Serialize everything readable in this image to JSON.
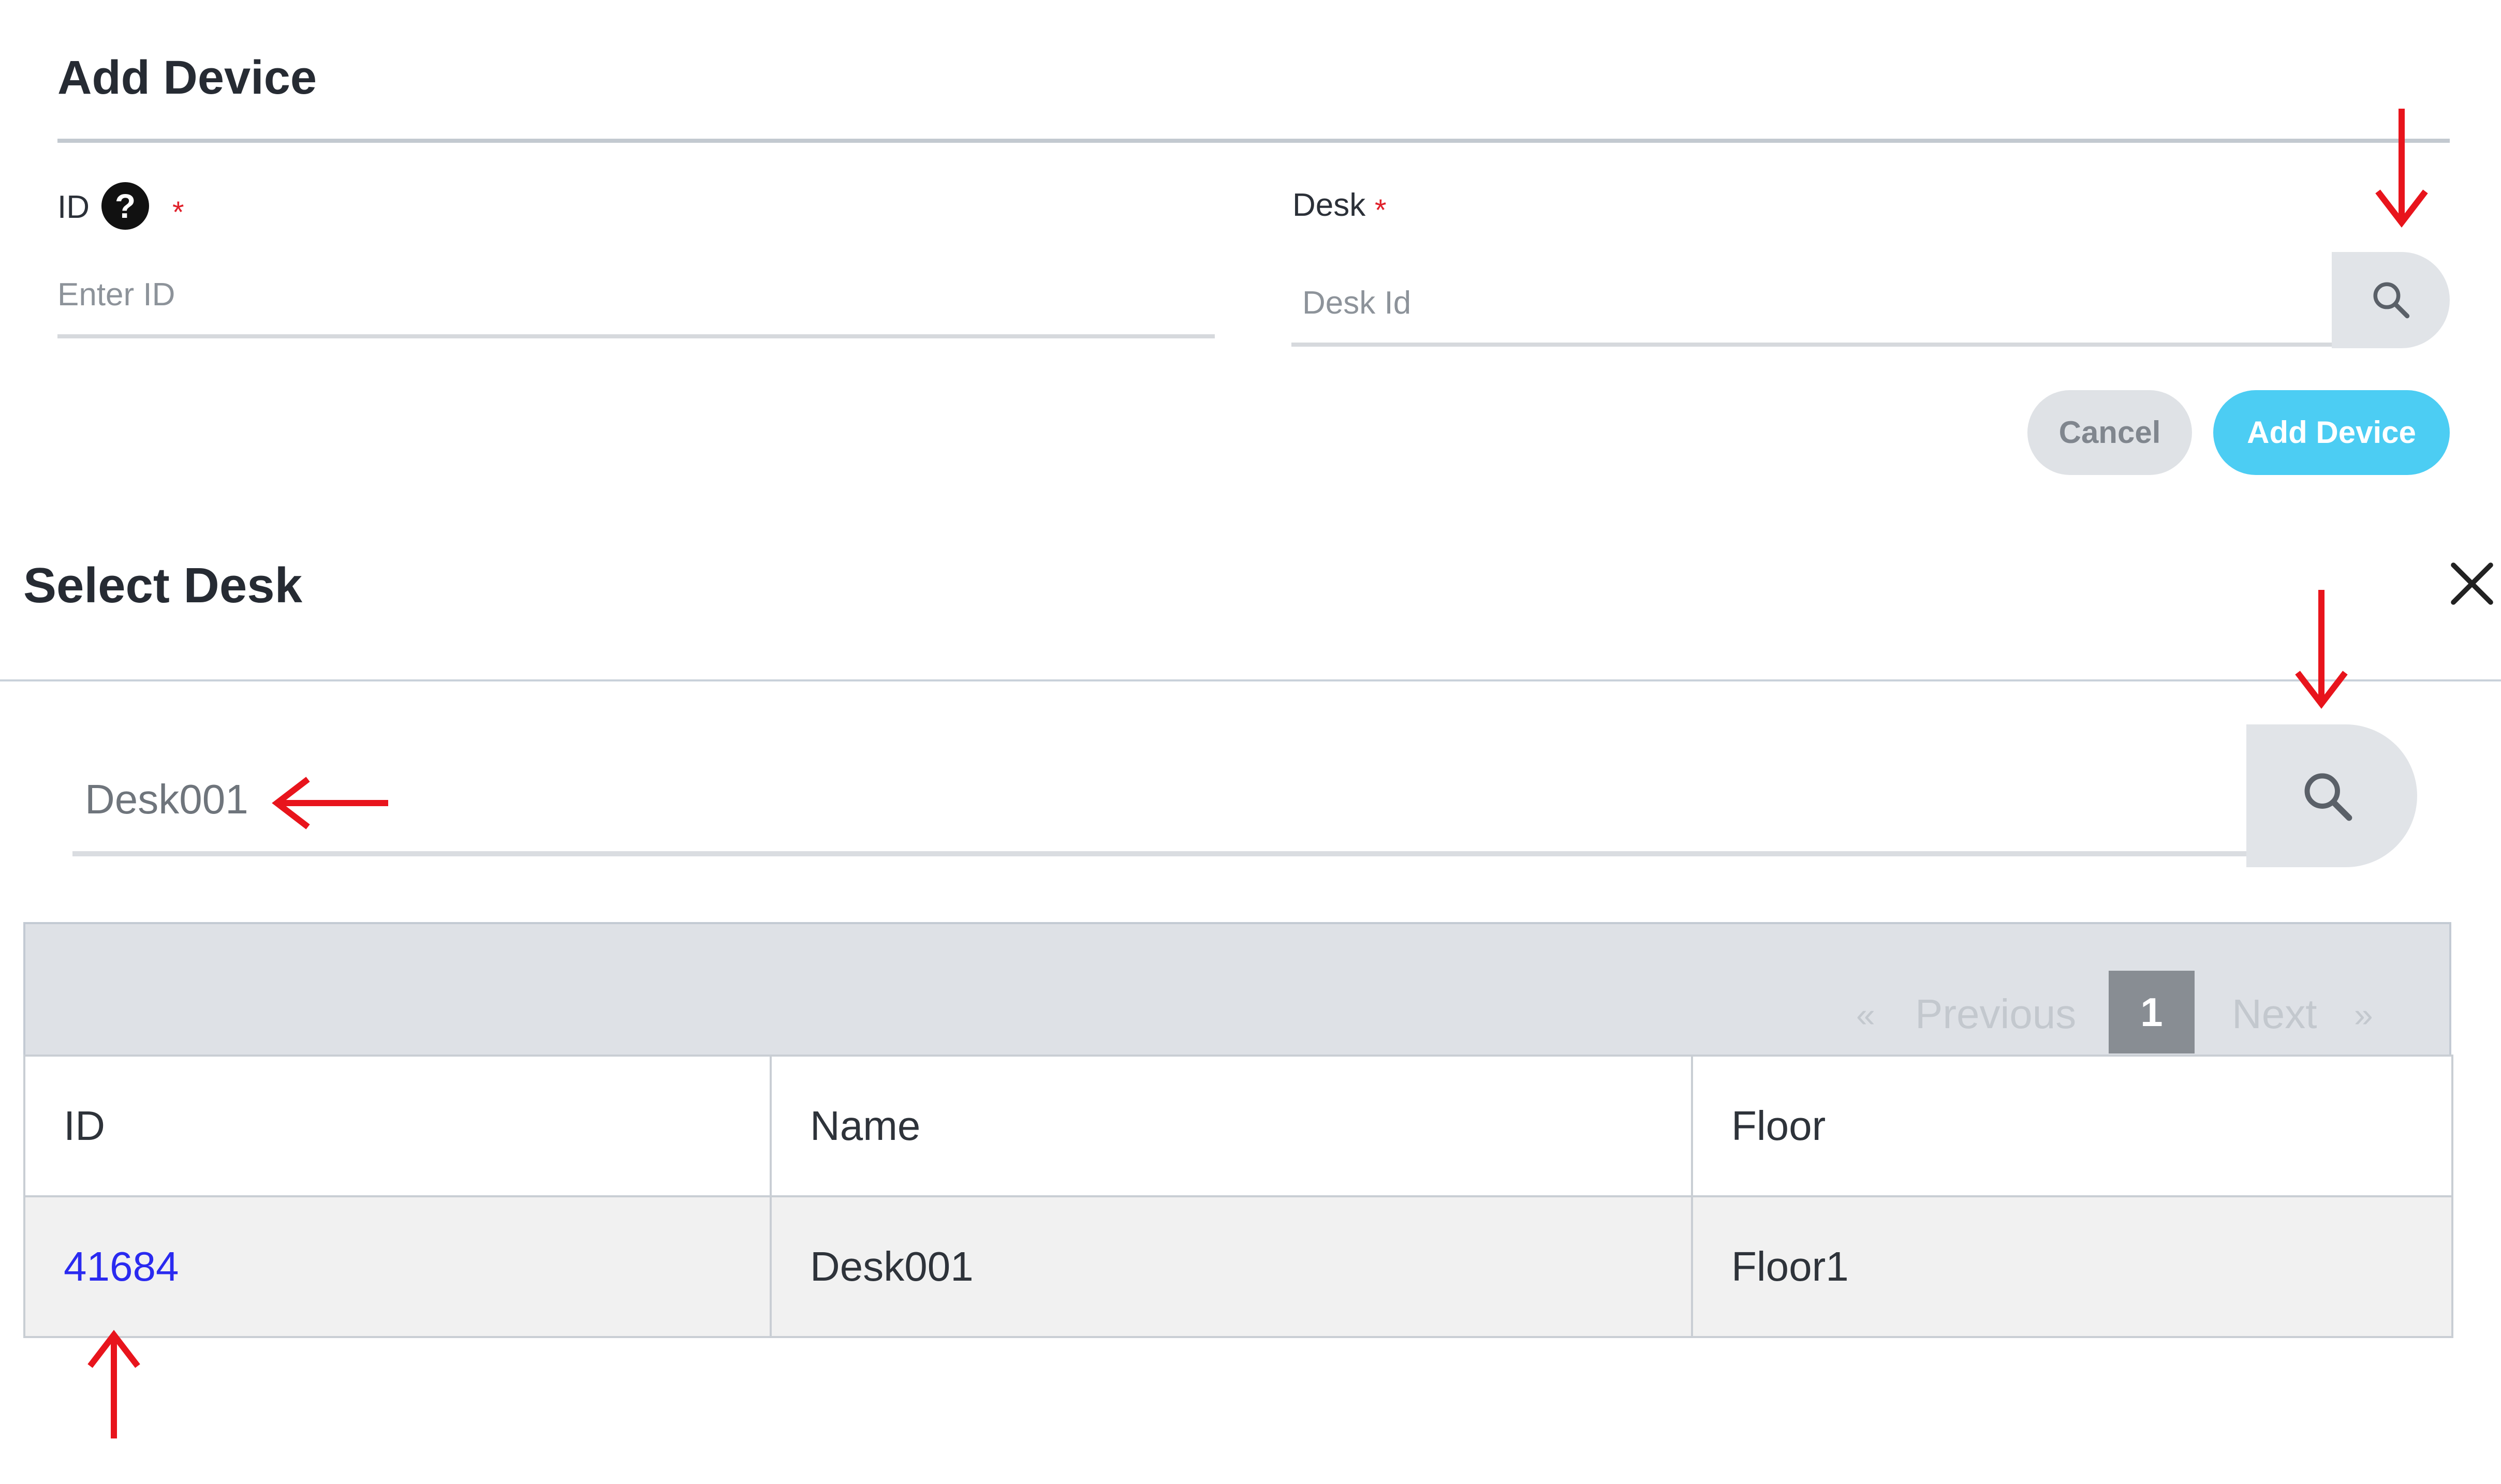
{
  "add_device": {
    "title": "Add Device",
    "id_field": {
      "label": "ID",
      "help_icon": "question-circle-icon",
      "required_mark": "*",
      "placeholder": "Enter ID",
      "value": ""
    },
    "desk_field": {
      "label": "Desk",
      "required_mark": "*",
      "placeholder": "Desk Id",
      "value": "",
      "search_icon": "search-icon"
    },
    "buttons": {
      "cancel": "Cancel",
      "submit": "Add Device"
    }
  },
  "select_desk": {
    "title": "Select Desk",
    "close_icon": "close-icon",
    "search": {
      "value": "Desk001",
      "icon": "search-icon"
    },
    "pagination": {
      "first": "«",
      "previous": "Previous",
      "current_page": "1",
      "next": "Next",
      "last": "»"
    },
    "table": {
      "columns": [
        "ID",
        "Name",
        "Floor"
      ],
      "rows": [
        {
          "id": "41684",
          "name": "Desk001",
          "floor": "Floor1"
        }
      ]
    }
  },
  "colors": {
    "accent": "#4ccdf3",
    "required": "#e0202a",
    "link": "#2a2af0",
    "annotation_arrow": "#e8141c"
  }
}
